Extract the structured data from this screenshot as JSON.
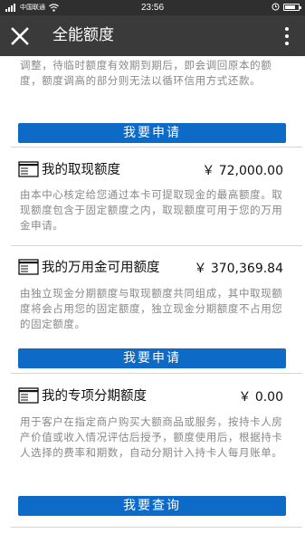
{
  "status": {
    "carrier": "中国联通",
    "time": "23:56",
    "battery_percent": 0.8
  },
  "header": {
    "title": "全能额度"
  },
  "intro_text": "调整，待临时额度有效期到期后，即会调回原本的额度，额度调高的部分则无法以循环信用方式还款。",
  "sections": [
    {
      "button": "我要申请"
    },
    {
      "title": "我的取现额度",
      "amount": "￥ 72,000.00",
      "description": "由本中心核定给您通过本卡可提取现金的最高额度。取现额度包含于固定额度之内，取现额度可用于您的万用金申请。"
    },
    {
      "title": "我的万用金可用额度",
      "amount": "￥ 370,369.84",
      "description": "由独立现金分期额度与取现额度共同组成，其中取现额度将会占用您的固定额度，独立现金分期额度不占用您的固定额度。",
      "button": "我要申请"
    },
    {
      "title": "我的专项分期额度",
      "amount": "￥ 0.00",
      "description": "用于客户在指定商户购买大额商品或服务，按持卡人房产价值或收入情况评估后授予，额度使用后，根据持卡人选择的费率和期数，自动分期计入持卡人每月账单。",
      "button": "我要查询"
    }
  ],
  "icons": {
    "card": "card-icon",
    "close": "close-icon",
    "more": "more-vertical-icon"
  },
  "colors": {
    "nav_bg": "#3a3a3a",
    "button_blue": "#0e6ac7",
    "desc_gray": "#888888"
  }
}
